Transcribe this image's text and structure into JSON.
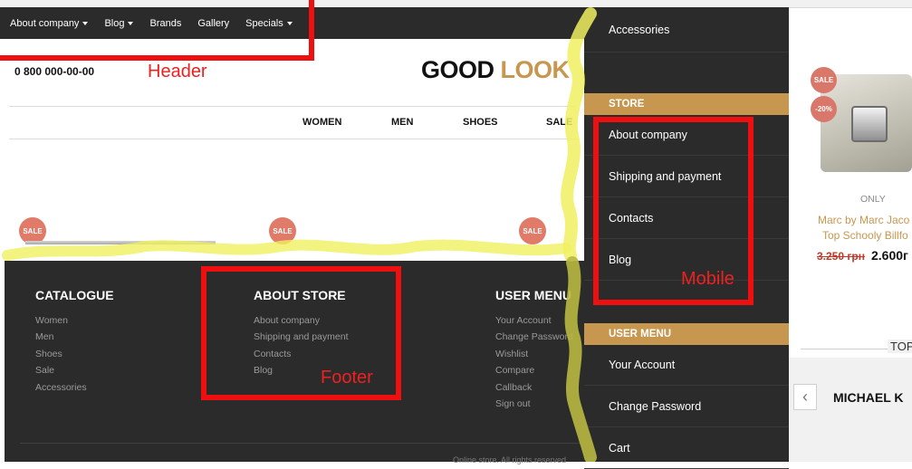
{
  "header_nav": [
    {
      "label": "About company",
      "dropdown": true
    },
    {
      "label": "Blog",
      "dropdown": true
    },
    {
      "label": "Brands",
      "dropdown": false
    },
    {
      "label": "Gallery",
      "dropdown": false
    },
    {
      "label": "Specials",
      "dropdown": true
    }
  ],
  "phone": "0 800 000-00-00",
  "logo": {
    "part1": "GOOD",
    "part2": "LOOK"
  },
  "categories": [
    "WOMEN",
    "MEN",
    "SHOES",
    "SALE"
  ],
  "sale_badge": "SALE",
  "footer": {
    "catalogue": {
      "title": "CATALOGUE",
      "links": [
        "Women",
        "Men",
        "Shoes",
        "Sale",
        "Accessories"
      ]
    },
    "about": {
      "title": "ABOUT STORE",
      "links": [
        "About company",
        "Shipping and payment",
        "Contacts",
        "Blog"
      ]
    },
    "user_menu": {
      "title": "USER MENU",
      "links": [
        "Your Account",
        "Change Password",
        "Wishlist",
        "Compare",
        "Callback",
        "Sign out"
      ]
    },
    "copyright": "Online store. All rights reserved"
  },
  "mobile_menu": {
    "top_item": "Accessories",
    "store_header": "STORE",
    "store_items": [
      "About company",
      "Shipping and payment",
      "Contacts",
      "Blog"
    ],
    "user_header": "USER MENU",
    "user_items": [
      "Your Account",
      "Change Password",
      "Cart"
    ]
  },
  "product": {
    "badge_sale": "SALE",
    "badge_discount": "-20%",
    "only": "ONLY",
    "name_line1": "Marc by Marc Jaco",
    "name_line2": "Top Schooly Billfo",
    "old_price": "3.250 грн",
    "new_price": "2.600г"
  },
  "top_label": "TOP",
  "brand": "MICHAEL K",
  "annotations": {
    "header": "Header",
    "footer": "Footer",
    "mobile": "Mobile"
  },
  "colors": {
    "dark": "#2b2b2b",
    "accent": "#c8974f",
    "sale": "#e07b69",
    "annotation": "#ee1010",
    "highlight": "#f0f060"
  }
}
